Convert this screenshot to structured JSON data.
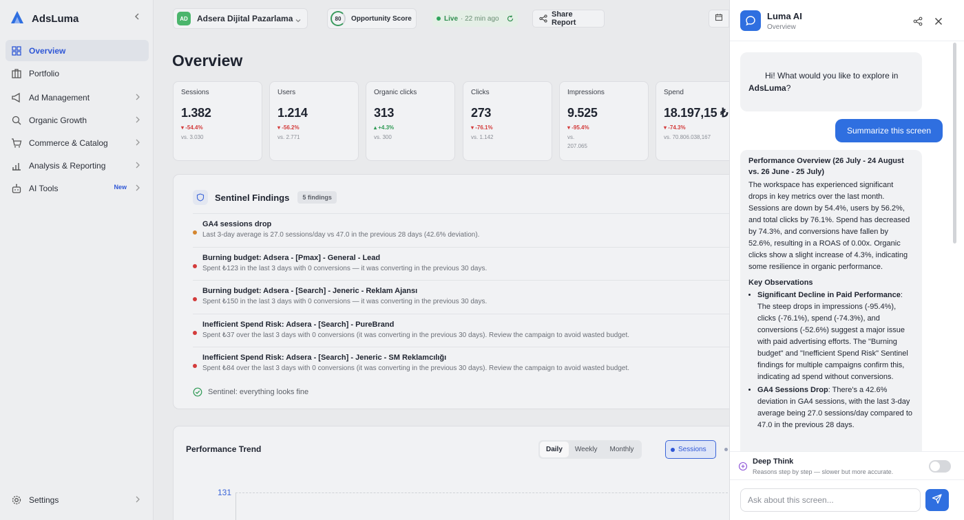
{
  "sidebar": {
    "brand": "AdsLuma",
    "items": [
      {
        "label": "Overview"
      },
      {
        "label": "Portfolio"
      },
      {
        "label": "Ad Management"
      },
      {
        "label": "Organic Growth"
      },
      {
        "label": "Commerce & Catalog"
      },
      {
        "label": "Analysis & Reporting"
      },
      {
        "label": "AI Tools",
        "badge": "New"
      }
    ],
    "settings": "Settings"
  },
  "topbar": {
    "workspace_initials": "AD",
    "workspace_name": "Adsera Dijital Pazarlama",
    "opportunity_score": "80",
    "opportunity_label": "Opportunity Score",
    "live_label": "Live",
    "live_time": "· 22 min ago",
    "share_label": "Share Report"
  },
  "page_title": "Overview",
  "kpis": [
    {
      "label": "Sessions",
      "value": "1.382",
      "delta": "▾ -54.4%",
      "vs": "vs. 3.030"
    },
    {
      "label": "Users",
      "value": "1.214",
      "delta": "▾ -56.2%",
      "vs": "vs. 2.771"
    },
    {
      "label": "Organic clicks",
      "value": "313",
      "delta": "▴ +4.3%",
      "vs": "vs. 300"
    },
    {
      "label": "Clicks",
      "value": "273",
      "delta": "▾ -76.1%",
      "vs": "vs. 1.142"
    },
    {
      "label": "Impressions",
      "value": "9.525",
      "delta": "▾ -95.4%",
      "vs": "vs. 207.065"
    },
    {
      "label": "Spend",
      "value": "18.197,15 ₺",
      "delta": "▾ -74.3%",
      "vs": "vs. 70.806.038,167"
    }
  ],
  "sentinel": {
    "title": "Sentinel Findings",
    "count": "5 findings",
    "findings": [
      {
        "title": "GA4 sessions drop",
        "desc": "Last 3-day average is 27.0 sessions/day vs 47.0 in the previous 28 days (42.6% deviation).",
        "color": "#d4862f"
      },
      {
        "title": "Burning budget: Adsera - [Pmax] - General - Lead",
        "desc": "Spent ₺123 in the last 3 days with 0 conversions — it was converting in the previous 30 days.",
        "color": "#d33b3b"
      },
      {
        "title": "Burning budget: Adsera - [Search] - Jeneric - Reklam Ajansı",
        "desc": "Spent ₺150 in the last 3 days with 0 conversions — it was converting in the previous 30 days.",
        "color": "#d33b3b"
      },
      {
        "title": "Inefficient Spend Risk: Adsera - [Search] - PureBrand",
        "desc": "Spent ₺37 over the last 3 days with 0 conversions (it was converting in the previous 30 days). Review the campaign to avoid wasted budget.",
        "color": "#d33b3b"
      },
      {
        "title": "Inefficient Spend Risk: Adsera - [Search] - Jeneric - SM Reklamcılığı",
        "desc": "Spent ₺84 over the last 3 days with 0 conversions (it was converting in the previous 30 days). Review the campaign to avoid wasted budget.",
        "color": "#d33b3b"
      }
    ],
    "ok": "Sentinel: everything looks fine"
  },
  "trend": {
    "title": "Performance Trend",
    "periods": [
      "Daily",
      "Weekly",
      "Monthly"
    ],
    "selected_period": "Daily",
    "metric": "Sessions",
    "y_tick": "131"
  },
  "assistant": {
    "title": "Luma AI",
    "subtitle": "Overview",
    "greeting_pre": "Hi! What would you like to explore in ",
    "greeting_brand": "AdsLuma",
    "greeting_post": "?",
    "user_message": "Summarize this screen",
    "reply": {
      "heading": "Performance Overview (26 July - 24 August vs. 26 June - 25 July)",
      "paragraph": "The workspace has experienced significant drops in key metrics over the last month. Sessions are down by 54.4%, users by 56.2%, and total clicks by 76.1%. Spend has decreased by 74.3%, and conversions have fallen by 52.6%, resulting in a ROAS of 0.00x. Organic clicks show a slight increase of 4.3%, indicating some resilience in organic performance.",
      "observations_title": "Key Observations",
      "observations": [
        {
          "bold": "Significant Decline in Paid Performance",
          "text": ": The steep drops in impressions (-95.4%), clicks (-76.1%), spend (-74.3%), and conversions (-52.6%) suggest a major issue with paid advertising efforts. The \"Burning budget\" and \"Inefficient Spend Risk\" Sentinel findings for multiple campaigns confirm this, indicating ad spend without conversions."
        },
        {
          "bold": "GA4 Sessions Drop",
          "text": ": There's a 42.6% deviation in GA4 sessions, with the last 3-day average being 27.0 sessions/day compared to 47.0 in the previous 28 days."
        }
      ]
    },
    "deep_think_title": "Deep Think",
    "deep_think_sub": "Reasons step by step — slower but more accurate.",
    "input_placeholder": "Ask about this screen..."
  },
  "colors": {
    "accent": "#2f6fe0",
    "active_nav": "#2f57d6",
    "negative": "#d33b3b",
    "positive": "#2f9a55",
    "warning": "#d4862f"
  }
}
